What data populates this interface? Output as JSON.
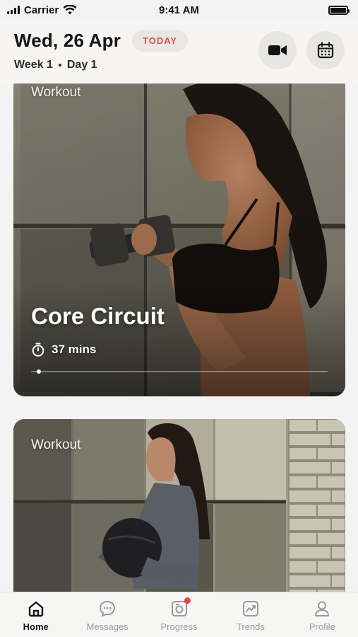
{
  "status_bar": {
    "carrier": "Carrier",
    "time": "9:41 AM"
  },
  "header": {
    "date": "Wed, 26 Apr",
    "today_badge": "TODAY",
    "week": "Week 1",
    "day": "Day 1",
    "video_icon": "video-camera-icon",
    "calendar_icon": "calendar-icon"
  },
  "cards": [
    {
      "category": "Workout",
      "title": "Core Circuit",
      "duration": "37 mins",
      "progress": 0.02
    },
    {
      "category": "Workout"
    }
  ],
  "tabs": [
    {
      "label": "Home",
      "icon": "home-icon",
      "active": true
    },
    {
      "label": "Messages",
      "icon": "chat-bubble-icon",
      "active": false
    },
    {
      "label": "Progress",
      "icon": "camera-progress-icon",
      "active": false,
      "badge": true
    },
    {
      "label": "Trends",
      "icon": "trend-chart-icon",
      "active": false
    },
    {
      "label": "Profile",
      "icon": "person-icon",
      "active": false
    }
  ],
  "colors": {
    "accent_red": "#d9534f",
    "badge_bg": "#e9e7e3",
    "notification_dot": "#e8453c"
  }
}
